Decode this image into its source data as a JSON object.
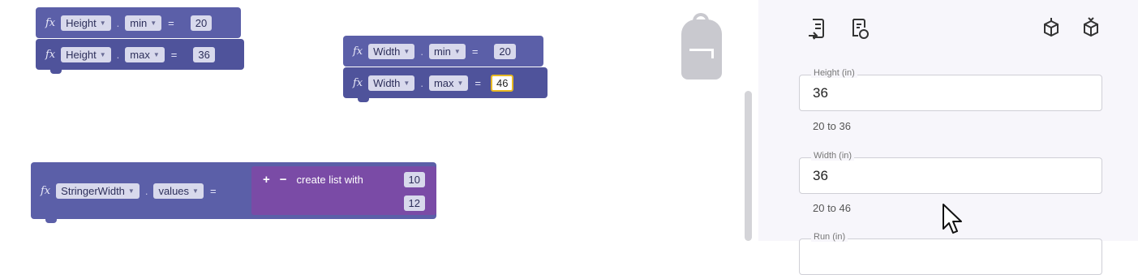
{
  "blocks": {
    "height_min": {
      "var": "Height",
      "prop": "min",
      "value": "20"
    },
    "height_max": {
      "var": "Height",
      "prop": "max",
      "value": "36"
    },
    "width_min": {
      "var": "Width",
      "prop": "min",
      "value": "20"
    },
    "width_max": {
      "var": "Width",
      "prop": "max",
      "value": "46"
    },
    "stringer": {
      "var": "StringerWidth",
      "prop": "values"
    },
    "list": {
      "plus": "+",
      "minus": "−",
      "label": "create list with",
      "items": [
        "10",
        "12"
      ]
    },
    "fx": "fx",
    "eq": "=",
    "dot": "."
  },
  "panel": {
    "height": {
      "label": "Height (in)",
      "value": "36",
      "range": "20 to 36"
    },
    "width": {
      "label": "Width (in)",
      "value": "36",
      "range": "20 to 46"
    },
    "run": {
      "label": "Run (in)"
    }
  },
  "icons": [
    "document-export-icon",
    "document-refresh-icon",
    "cube-export-icon",
    "cube-import-icon",
    "backpack-icon",
    "cursor-icon"
  ]
}
